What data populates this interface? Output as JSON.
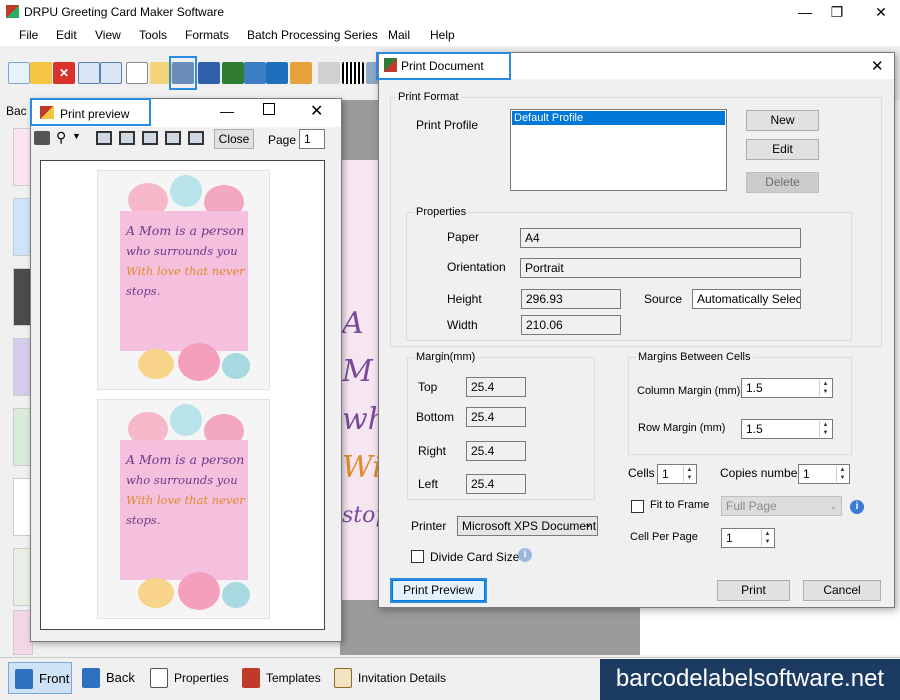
{
  "app": {
    "title": "DRPU Greeting Card Maker Software",
    "menu": [
      "File",
      "Edit",
      "View",
      "Tools",
      "Formats",
      "Batch Processing Series",
      "Mail",
      "Help"
    ],
    "side_label": "Bac"
  },
  "preview": {
    "title": "Print preview",
    "close_label": "Close",
    "page_label": "Page",
    "page_value": "1",
    "card_text": [
      "A Mom is a person",
      "who surrounds you",
      "With love that never",
      "stops."
    ],
    "bg_card_text": [
      "A M",
      "who",
      "Wit",
      "stops"
    ]
  },
  "dialog": {
    "title": "Print Document",
    "print_format_label": "Print Format",
    "print_profile_label": "Print Profile",
    "profiles": [
      "Default Profile"
    ],
    "new_label": "New",
    "edit_label": "Edit",
    "delete_label": "Delete",
    "properties_label": "Properties",
    "paper_label": "Paper",
    "paper_value": "A4",
    "orientation_label": "Orientation",
    "orientation_value": "Portrait",
    "height_label": "Height",
    "height_value": "296.93",
    "source_label": "Source",
    "source_value": "Automatically Select",
    "width_label": "Width",
    "width_value": "210.06",
    "margin_label": "Margin(mm)",
    "top_label": "Top",
    "top_value": "25.4",
    "bottom_label": "Bottom",
    "bottom_value": "25.4",
    "right_label": "Right",
    "right_value": "25.4",
    "left_label": "Left",
    "left_value": "25.4",
    "cells_margin_label": "Margins Between Cells",
    "column_margin_label": "Column Margin (mm)",
    "column_margin_value": "1.5",
    "row_margin_label": "Row Margin (mm)",
    "row_margin_value": "1.5",
    "cells_label": "Cells",
    "cells_value": "1",
    "copies_label": "Copies number",
    "copies_value": "1",
    "fit_frame_label": "Fit to Frame",
    "fit_frame_value": "Full Page",
    "printer_label": "Printer",
    "printer_value": "Microsoft XPS Document",
    "cell_per_page_label": "Cell Per Page",
    "cell_per_page_value": "1",
    "divide_card_label": "Divide Card Size",
    "print_preview_label": "Print Preview",
    "print_label": "Print",
    "cancel_label": "Cancel"
  },
  "bottom_tabs": {
    "front": "Front",
    "back": "Back",
    "properties": "Properties",
    "templates": "Templates",
    "invitation": "Invitation Details"
  },
  "brand": "barcodelabelsoftware.net",
  "colors": {
    "accent_blue": "#2b8be0",
    "card_pink": "#f4c0de",
    "brand_bg": "#1b3b63",
    "text_purple": "#6a3a8a",
    "text_orange": "#e08a2a"
  }
}
